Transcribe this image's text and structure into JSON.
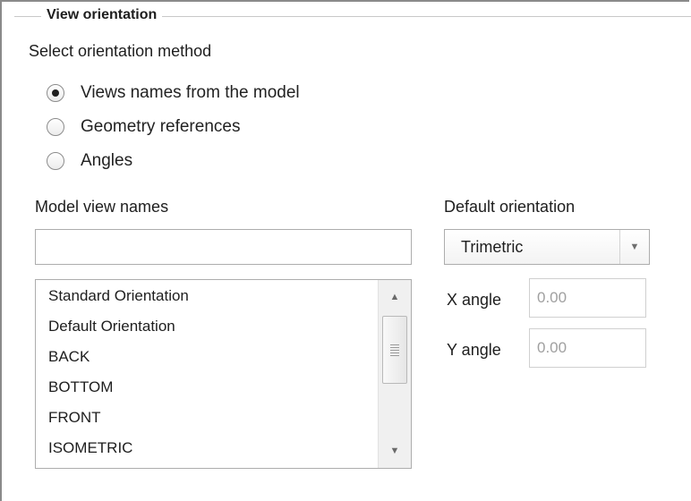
{
  "group": {
    "title": "View orientation"
  },
  "method": {
    "label": "Select orientation method",
    "options": [
      {
        "label": "Views names from the model",
        "selected": true
      },
      {
        "label": "Geometry references",
        "selected": false
      },
      {
        "label": "Angles",
        "selected": false
      }
    ]
  },
  "model_views": {
    "label": "Model view names",
    "search_value": "",
    "items": [
      "Standard Orientation",
      "Default Orientation",
      "BACK",
      "BOTTOM",
      "FRONT",
      "ISOMETRIC"
    ],
    "scroll_up_icon": "triangle-up-icon",
    "scroll_down_icon": "triangle-down-icon"
  },
  "default_orientation": {
    "label": "Default orientation",
    "value": "Trimetric",
    "dropdown_icon": "triangle-down-icon"
  },
  "angles": {
    "x_label": "X angle",
    "x_value": "0.00",
    "y_label": "Y angle",
    "y_value": "0.00"
  }
}
